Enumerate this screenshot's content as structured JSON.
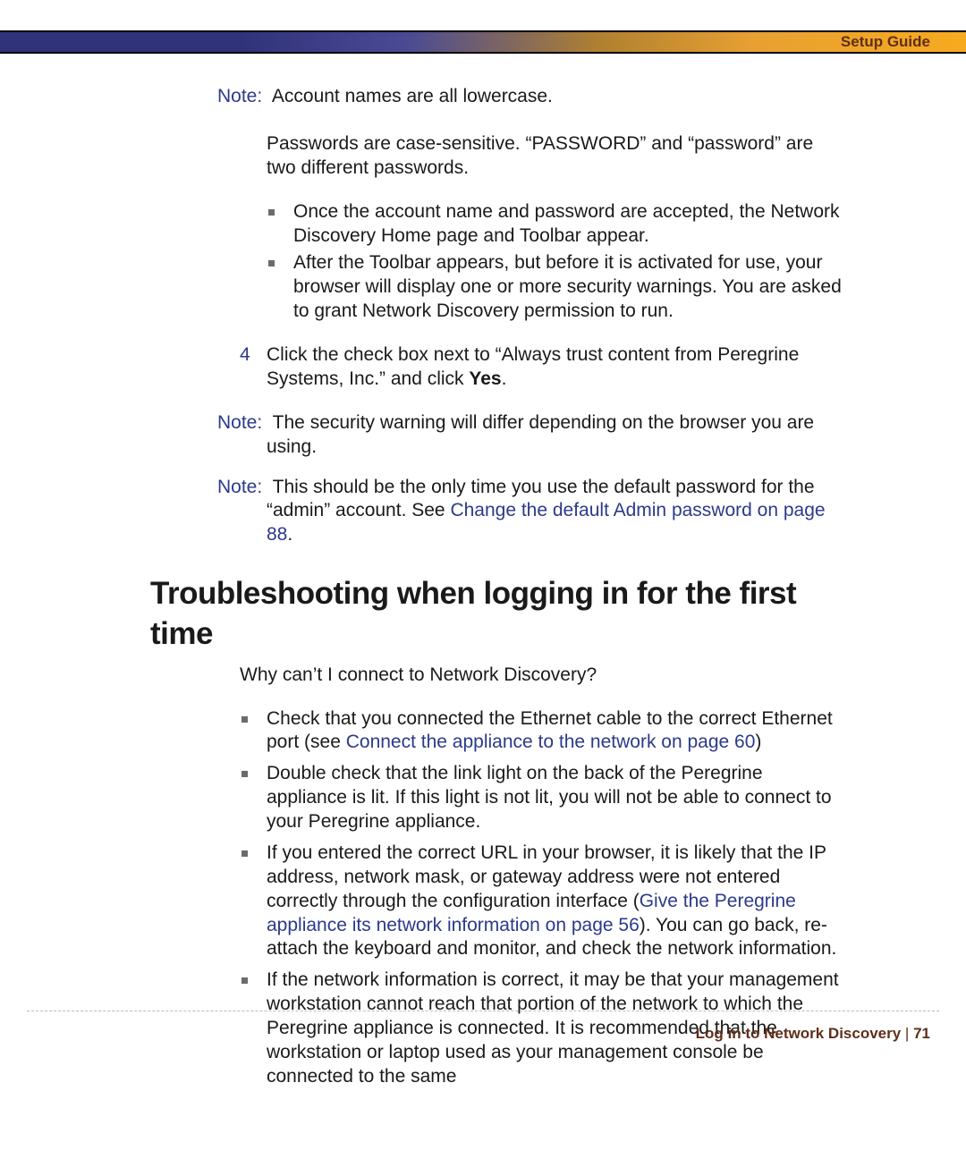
{
  "header": {
    "title": "Setup Guide"
  },
  "note1": {
    "label": "Note:",
    "text": "Account names are all lowercase."
  },
  "passwords_para": "Passwords are case-sensitive. “PASSWORD” and “password” are two different passwords.",
  "bullets_a": [
    "Once the account name and password are accepted, the Network Discovery Home page and Toolbar appear.",
    "After the Toolbar appears, but before it is activated for use, your browser will display one or more security warnings. You are asked to grant Network Discovery permission to run."
  ],
  "step4": {
    "num": "4",
    "pre": "Click the check box next to “Always trust content from Peregrine Systems, Inc.” and click ",
    "bold": "Yes",
    "post": "."
  },
  "note2": {
    "label": "Note:",
    "text": "The security warning will differ depending on the browser you are using."
  },
  "note3": {
    "label": "Note:",
    "pre": "This should be the only time you use the default password for the “admin” account. See ",
    "link": "Change the default Admin password on page 88",
    "post": "."
  },
  "heading": "Troubleshooting when logging in for the first time",
  "subq": "Why can’t I connect to Network Discovery?",
  "tips": [
    {
      "pre": "Check that you connected the Ethernet cable to the correct Ethernet port (see ",
      "link": "Connect the appliance to the network on page 60",
      "post": ")"
    },
    {
      "pre": "Double check that the link light on the back of the Peregrine appliance is lit. If this light is not lit, you will not be able to connect to your Peregrine appliance.",
      "link": "",
      "post": ""
    },
    {
      "pre": "If you entered the correct URL in your browser, it is likely that the IP address, network mask, or gateway address were not entered correctly through the configuration interface (",
      "link": "Give the Peregrine appliance its network information on page 56",
      "post": "). You can go back, re-attach the keyboard and monitor, and check the network information."
    },
    {
      "pre": "If the network information is correct, it may be that your management workstation cannot reach that portion of the network to which the Peregrine appliance is connected. It is recommended that the workstation or laptop used as your management console be connected to the same",
      "link": "",
      "post": ""
    }
  ],
  "footer": {
    "chapter": "Log in to Network Discovery",
    "sep": " | ",
    "page": "71"
  }
}
